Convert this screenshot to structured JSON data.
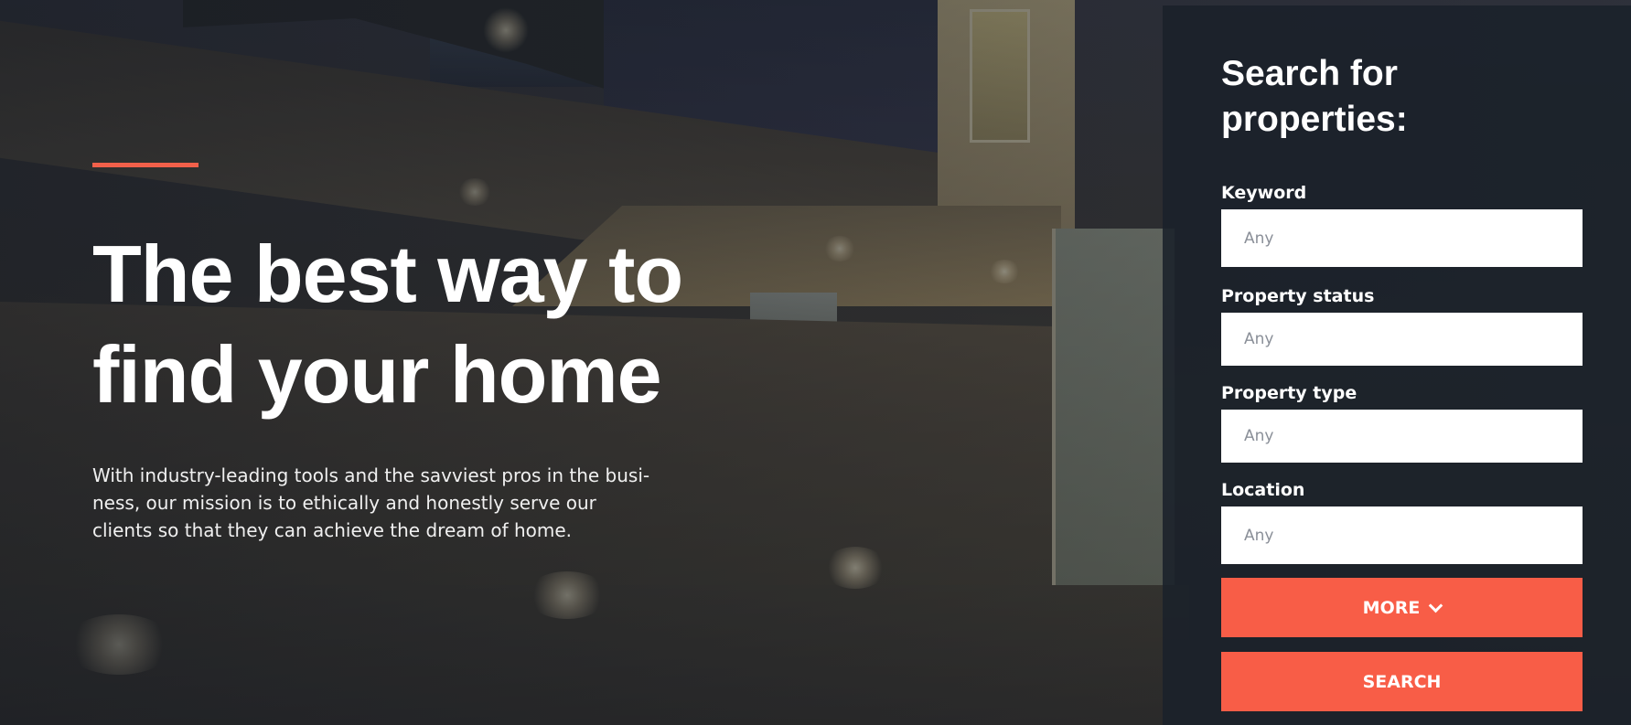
{
  "hero": {
    "title_line1": "The best way to",
    "title_line2": "find your home",
    "description": "With industry-leading tools and the savviest pros in the busi-ness, our mission is to ethically and honestly serve our clients so that they can achieve the dream of home.",
    "accent_color": "#f2604a"
  },
  "search": {
    "title_line1": "Search for",
    "title_line2": "properties:",
    "fields": [
      {
        "label": "Keyword",
        "placeholder": "Any"
      },
      {
        "label": "Property status",
        "placeholder": "Any"
      },
      {
        "label": "Property type",
        "placeholder": "Any"
      },
      {
        "label": "Location",
        "placeholder": "Any"
      }
    ],
    "more_label": "MORE",
    "more_icon": "chevron-down-icon",
    "search_label": "SEARCH",
    "button_color": "#f85d47",
    "panel_color": "#1a212a"
  }
}
